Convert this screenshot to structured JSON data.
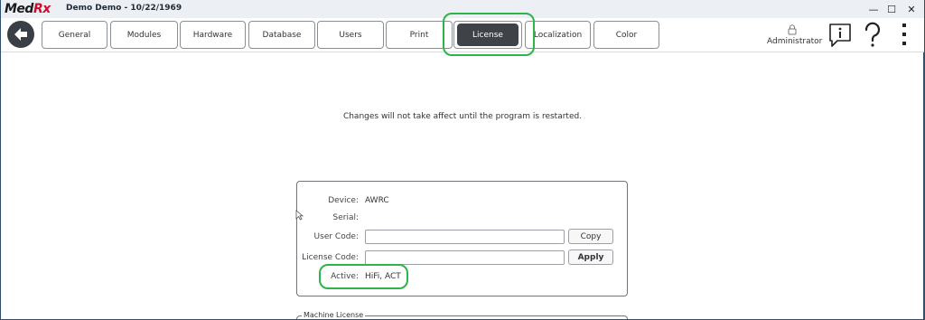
{
  "app": {
    "logo_main": "Med",
    "logo_accent": "Rx",
    "window_title": "Demo Demo - 10/22/1969",
    "controls": {
      "minimize": "—",
      "maximize": "☐",
      "close": "✕"
    }
  },
  "toolbar": {
    "tabs": [
      {
        "label": "General"
      },
      {
        "label": "Modules"
      },
      {
        "label": "Hardware"
      },
      {
        "label": "Database"
      },
      {
        "label": "Users"
      },
      {
        "label": "Print"
      },
      {
        "label": "License"
      },
      {
        "label": "Localization"
      },
      {
        "label": "Color"
      }
    ],
    "active_tab": "License",
    "user": "Administrator"
  },
  "notice": "Changes will not take affect until the program is restarted.",
  "license": {
    "device_label": "Device:",
    "device_value": "AWRC",
    "serial_label": "Serial:",
    "serial_value": "",
    "user_code_label": "User Code:",
    "user_code_value": "",
    "license_code_label": "License Code:",
    "license_code_value": "",
    "copy_label": "Copy",
    "apply_label": "Apply",
    "active_label": "Active:",
    "active_value": "HiFi, ACT"
  },
  "machine": {
    "legend": "Machine License"
  },
  "colors": {
    "highlight": "#2eb44a",
    "active_tab": "#3f4347",
    "logo_rx": "#c8102e"
  }
}
